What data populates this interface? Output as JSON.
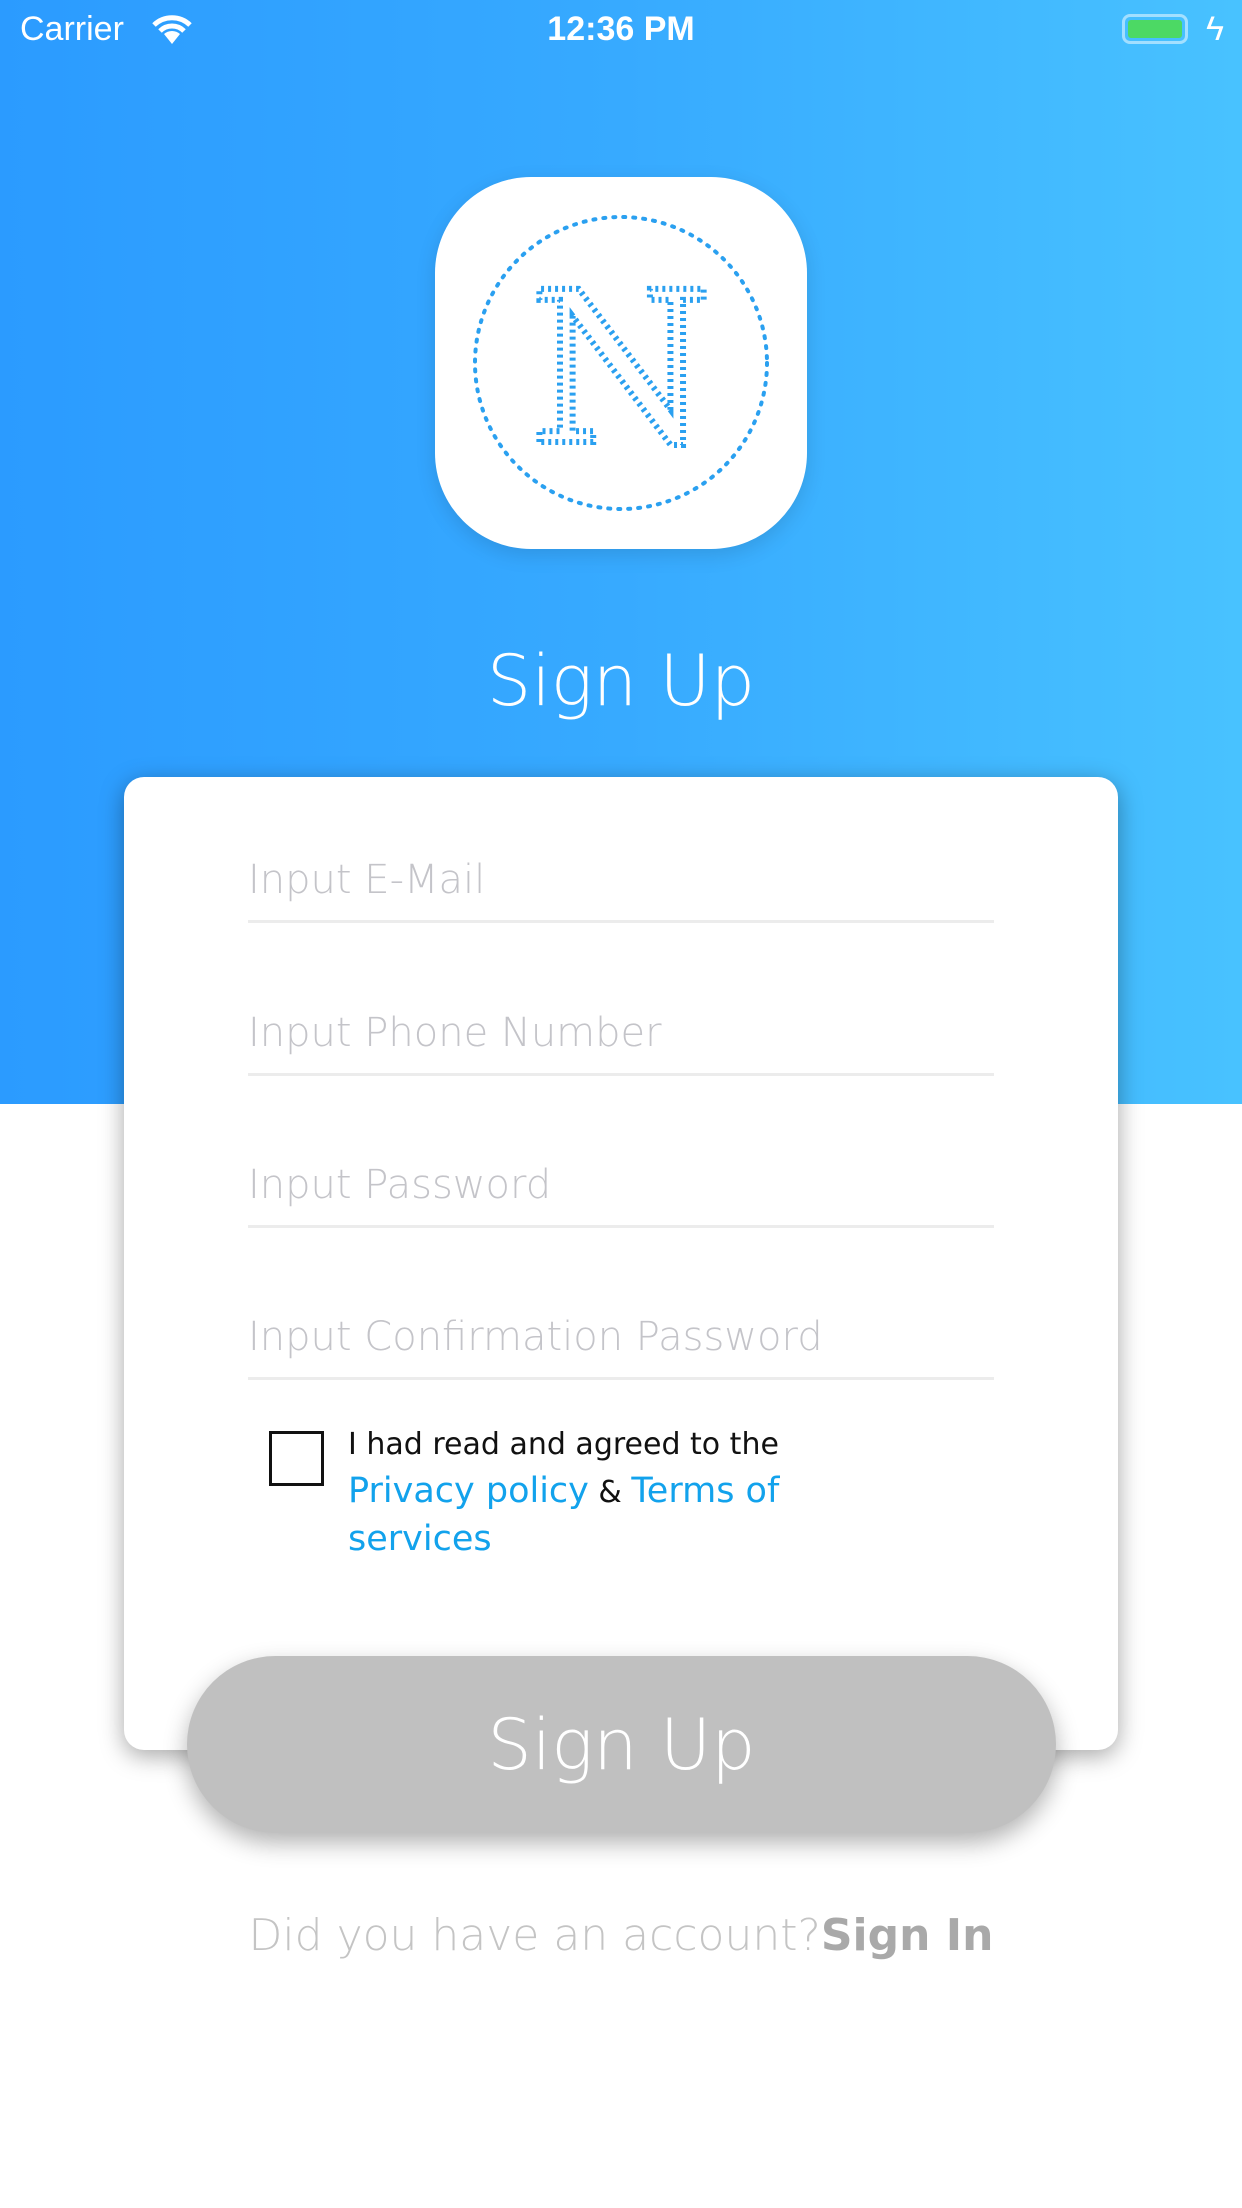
{
  "status_bar": {
    "carrier": "Carrier",
    "time": "12:36 PM",
    "battery_level": 1.0
  },
  "logo": {
    "letter": "N"
  },
  "title": "Sign Up",
  "form": {
    "email_placeholder": "Input E-Mail",
    "phone_placeholder": "Input Phone Number",
    "password_placeholder": "Input Password",
    "confirm_placeholder": "Input Confirmation Password",
    "agree_checked": false,
    "terms_prefix": "I had read and agreed to the ",
    "privacy_link": "Privacy policy",
    "terms_amp": " & ",
    "terms_link": "Terms of services"
  },
  "signup_button": "Sign Up",
  "footer": {
    "question": "Did you have an account?",
    "signin_link": "Sign In"
  },
  "colors": {
    "gradient_start": "#2b9bff",
    "gradient_end": "#48c2ff",
    "link": "#12a2ec",
    "button_disabled": "#c0c0c0"
  }
}
